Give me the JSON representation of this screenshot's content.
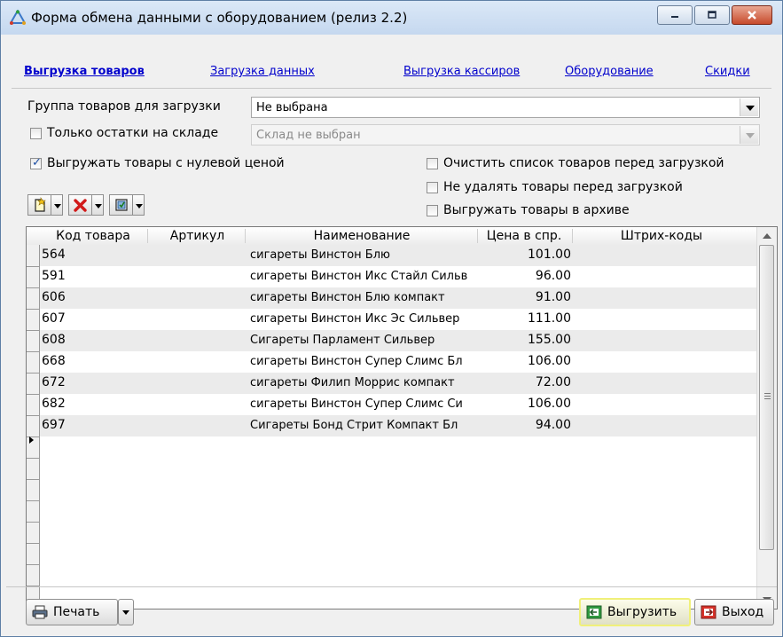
{
  "window": {
    "title": "Форма обмена данными с оборудованием (релиз 2.2)",
    "icons": {
      "app": "network-icon",
      "minimize": "minimize-icon",
      "maximize": "maximize-icon",
      "close": "close-icon"
    }
  },
  "tabs": [
    {
      "label": "Выгрузка товаров",
      "active": true
    },
    {
      "label": "Загрузка данных",
      "active": false
    },
    {
      "label": "Выгрузка кассиров",
      "active": false
    },
    {
      "label": "Оборудование",
      "active": false
    },
    {
      "label": "Скидки",
      "active": false
    }
  ],
  "filters": {
    "group_label": "Группа товаров для загрузки",
    "group_value": "Не выбрана",
    "stock_only_label": "Только остатки на складе",
    "stock_only_checked": false,
    "warehouse_placeholder": "Склад не выбран",
    "zero_price_label": "Выгружать товары с нулевой ценой",
    "zero_price_checked": true,
    "clear_list_label": "Очистить список товаров перед загрузкой",
    "clear_list_checked": false,
    "no_delete_label": "Не удалять товары перед загрузкой",
    "no_delete_checked": false,
    "archive_label": "Выгружать товары в архиве",
    "archive_checked": false
  },
  "toolbar": {
    "icons": [
      "add-icon",
      "delete-icon",
      "select-icon"
    ]
  },
  "table": {
    "columns": [
      "Код товара",
      "Артикул",
      "Наименование",
      "Цена в спр.",
      "Штрих-коды"
    ],
    "rows": [
      {
        "code": "564",
        "article": "",
        "name": "сигареты Винстон Блю",
        "price": "101.00",
        "barcodes": ""
      },
      {
        "code": "591",
        "article": "",
        "name": "сигареты Винстон Икс Стайл Сильв",
        "price": "96.00",
        "barcodes": ""
      },
      {
        "code": "606",
        "article": "",
        "name": "сигареты Винстон Блю компакт",
        "price": "91.00",
        "barcodes": ""
      },
      {
        "code": "607",
        "article": "",
        "name": "сигареты Винстон Икс Эс Сильвер",
        "price": "111.00",
        "barcodes": ""
      },
      {
        "code": "608",
        "article": "",
        "name": "Сигареты Парламент Сильвер",
        "price": "155.00",
        "barcodes": ""
      },
      {
        "code": "668",
        "article": "",
        "name": "сигареты Винстон Супер Слимс Бл",
        "price": "106.00",
        "barcodes": ""
      },
      {
        "code": "672",
        "article": "",
        "name": "сигареты Филип Моррис  компакт",
        "price": "72.00",
        "barcodes": ""
      },
      {
        "code": "682",
        "article": "",
        "name": "сигареты Винстон Супер Слимс Си",
        "price": "106.00",
        "barcodes": ""
      },
      {
        "code": "697",
        "article": "",
        "name": "Сигареты Бонд Стрит Компакт Бл",
        "price": "94.00",
        "barcodes": ""
      }
    ],
    "current_row": 8
  },
  "footer": {
    "print_label": "Печать",
    "export_label": "Выгрузить",
    "exit_label": "Выход",
    "icons": {
      "print": "printer-icon",
      "export": "export-icon",
      "exit": "exit-icon"
    }
  },
  "colors": {
    "link": "#0000cc",
    "highlight": "#f0f07a"
  }
}
